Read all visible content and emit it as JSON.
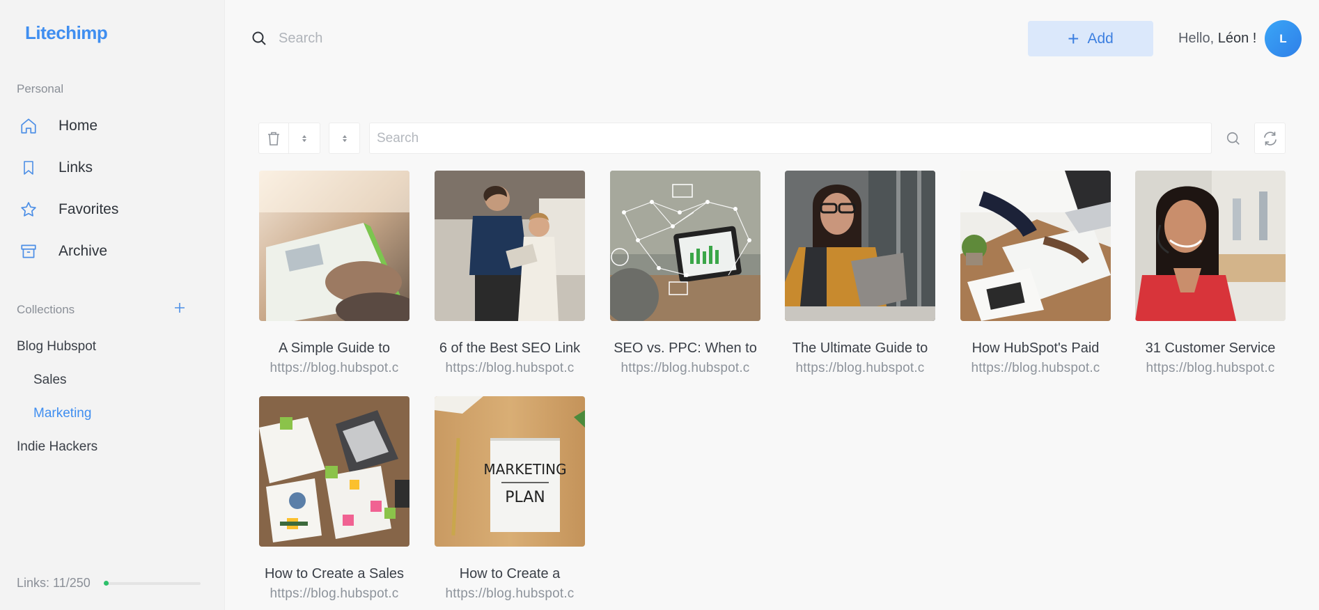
{
  "app": {
    "logo": "Litechimp"
  },
  "sidebar": {
    "personal_label": "Personal",
    "nav": [
      {
        "label": "Home",
        "icon": "home-icon"
      },
      {
        "label": "Links",
        "icon": "bookmark-icon"
      },
      {
        "label": "Favorites",
        "icon": "star-icon"
      },
      {
        "label": "Archive",
        "icon": "archive-icon"
      }
    ],
    "collections_label": "Collections",
    "collections": [
      {
        "label": "Blog Hubspot",
        "level": 0
      },
      {
        "label": "Sales",
        "level": 1
      },
      {
        "label": "Marketing",
        "level": 1,
        "active": true
      },
      {
        "label": "Indie Hackers",
        "level": 0
      }
    ],
    "links_count": "Links: 11/250",
    "links_used": 11,
    "links_limit": 250
  },
  "topbar": {
    "search_placeholder": "Search",
    "add_label": "Add",
    "hello_prefix": "Hello,",
    "user_name": "Léon !",
    "avatar_initial": "L"
  },
  "toolbar": {
    "search_placeholder": "Search"
  },
  "cards": [
    {
      "title": "A Simple Guide to",
      "url": "https://blog.hubspot.c",
      "thumb": "tablet-hands"
    },
    {
      "title": "6 of the Best SEO Link",
      "url": "https://blog.hubspot.c",
      "thumb": "office-couple"
    },
    {
      "title": "SEO vs. PPC: When to",
      "url": "https://blog.hubspot.c",
      "thumb": "network-tablet"
    },
    {
      "title": "The Ultimate Guide to",
      "url": "https://blog.hubspot.c",
      "thumb": "woman-laptop"
    },
    {
      "title": "How HubSpot's Paid",
      "url": "https://blog.hubspot.c",
      "thumb": "desk-charts"
    },
    {
      "title": "31 Customer Service",
      "url": "https://blog.hubspot.c",
      "thumb": "headset-agent"
    },
    {
      "title": "How to Create a Sales",
      "url": "https://blog.hubspot.c",
      "thumb": "desk-sticky"
    },
    {
      "title": "How to Create a",
      "url": "https://blog.hubspot.c",
      "thumb": "marketing-plan",
      "thumb_text": [
        "MARKETING",
        "PLAN"
      ]
    }
  ],
  "colors": {
    "accent": "#3f8ef0",
    "progress": "#2ec06b",
    "add_bg": "#dbe8fb"
  }
}
